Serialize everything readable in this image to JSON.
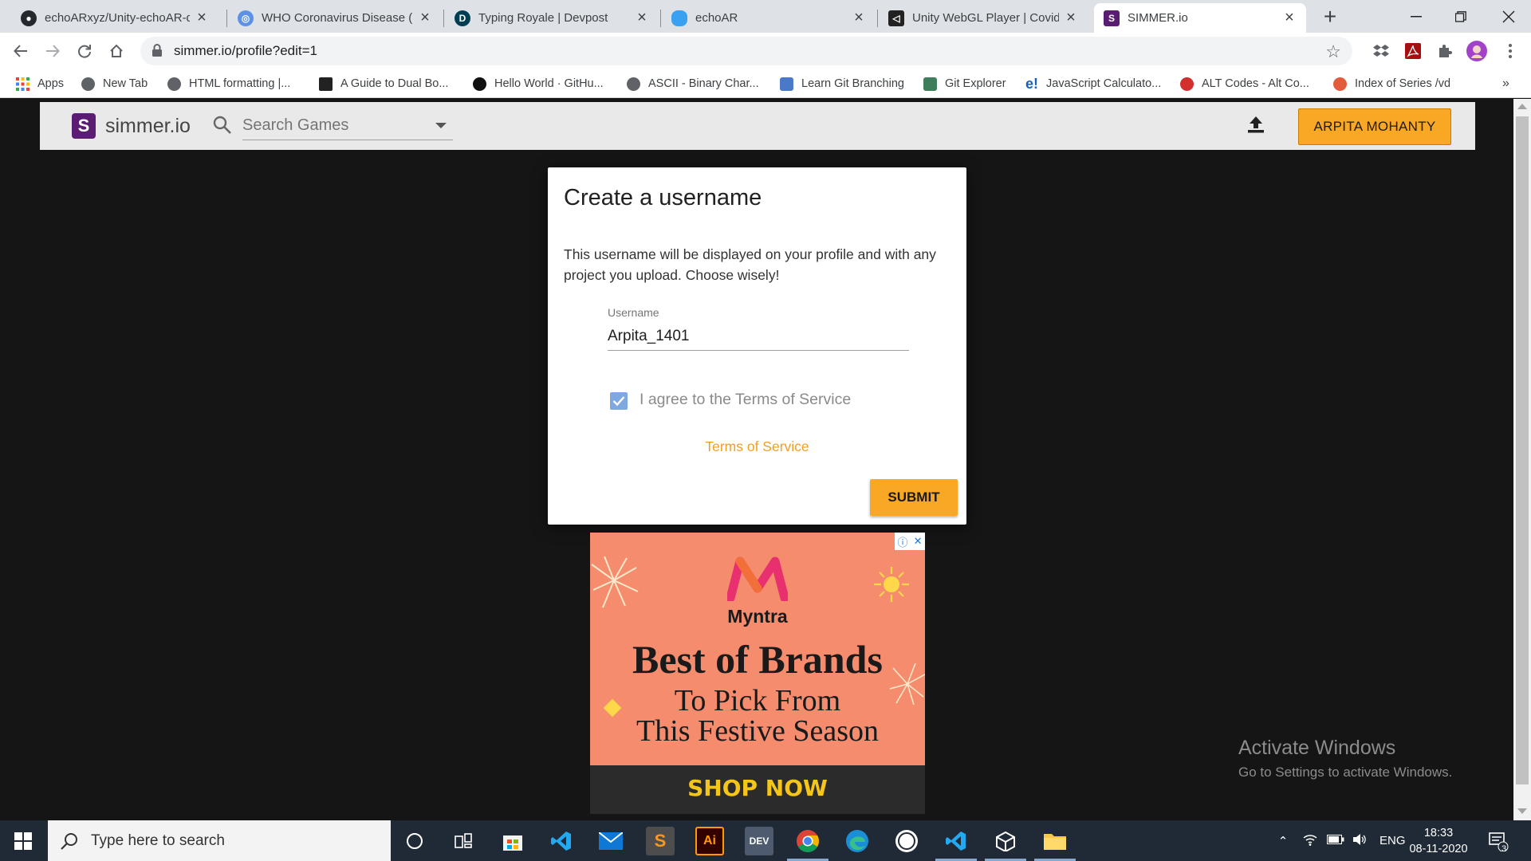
{
  "browser": {
    "tabs": [
      {
        "title": "echoARxyz/Unity-echoAR-de",
        "icon": "github-icon",
        "color": "#24292e"
      },
      {
        "title": "WHO Coronavirus Disease (C",
        "icon": "who-icon",
        "color": "#5b92e5"
      },
      {
        "title": "Typing Royale | Devpost",
        "icon": "devpost-icon",
        "color": "#003e54"
      },
      {
        "title": "echoAR",
        "icon": "echoar-cloud-icon",
        "color": "#3aa0f0"
      },
      {
        "title": "Unity WebGL Player | Covid \\",
        "icon": "unity-icon",
        "color": "#222222"
      },
      {
        "title": "SIMMER.io",
        "icon": "simmer-icon",
        "color": "#5b1d73"
      }
    ],
    "url": "simmer.io/profile?edit=1",
    "bookmarks": [
      {
        "label": "Apps",
        "icon": "apps-grid-icon"
      },
      {
        "label": "New Tab",
        "icon": "globe-icon"
      },
      {
        "label": "HTML formatting |...",
        "icon": "globe-icon"
      },
      {
        "label": "A Guide to Dual Bo...",
        "icon": "dualboot-icon"
      },
      {
        "label": "Hello World · GitHu...",
        "icon": "github-icon"
      },
      {
        "label": "ASCII - Binary Char...",
        "icon": "globe-icon"
      },
      {
        "label": "Learn Git Branching",
        "icon": "learngit-icon"
      },
      {
        "label": "Git Explorer",
        "icon": "git-explorer-icon"
      },
      {
        "label": "JavaScript Calculato...",
        "icon": "e-icon"
      },
      {
        "label": "ALT Codes - Alt Co...",
        "icon": "altcodes-icon"
      },
      {
        "label": "Index of Series /vd",
        "icon": "index-icon"
      }
    ],
    "more_bookmarks": "»"
  },
  "site": {
    "logo_text": "simmer.io",
    "logo_letter": "S",
    "search_placeholder": "Search Games",
    "user_button": "ARPITA MOHANTY",
    "accent": "#f9a825"
  },
  "dialog": {
    "title": "Create a username",
    "description": "This username will be displayed on your profile and with any project you upload. Choose wisely!",
    "username_label": "Username",
    "username_value": "Arpita_1401",
    "agree_label": "I agree to the Terms of Service",
    "agree_checked": true,
    "tos_link": "Terms of Service",
    "submit": "SUBMIT"
  },
  "ad": {
    "brand": "Myntra",
    "headline": "Best of Brands",
    "sub_line1": "To Pick From",
    "sub_line2": "This Festive Season",
    "cta": "SHOP NOW",
    "background": "#f58c6e"
  },
  "watermark": {
    "title": "Activate Windows",
    "subtitle": "Go to Settings to activate Windows."
  },
  "taskbar": {
    "search_placeholder": "Type here to search",
    "language": "ENG",
    "time": "18:33",
    "date": "08-11-2020",
    "notification_count": "3"
  }
}
